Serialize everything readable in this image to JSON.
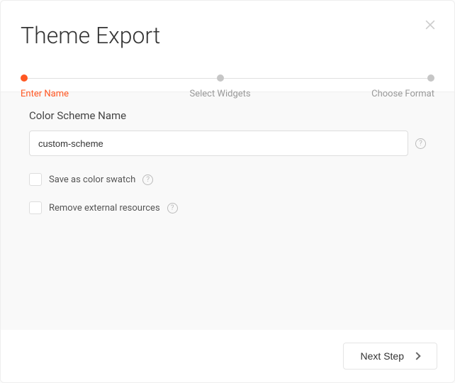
{
  "dialog": {
    "title": "Theme Export"
  },
  "stepper": {
    "steps": [
      {
        "label": "Enter Name",
        "active": true
      },
      {
        "label": "Select Widgets",
        "active": false
      },
      {
        "label": "Choose Format",
        "active": false
      }
    ]
  },
  "form": {
    "field_label": "Color Scheme Name",
    "name_value": "custom-scheme",
    "checkbox1_label": "Save as color swatch",
    "checkbox2_label": "Remove external resources"
  },
  "footer": {
    "next_label": "Next Step"
  },
  "colors": {
    "accent": "#ff5722"
  }
}
